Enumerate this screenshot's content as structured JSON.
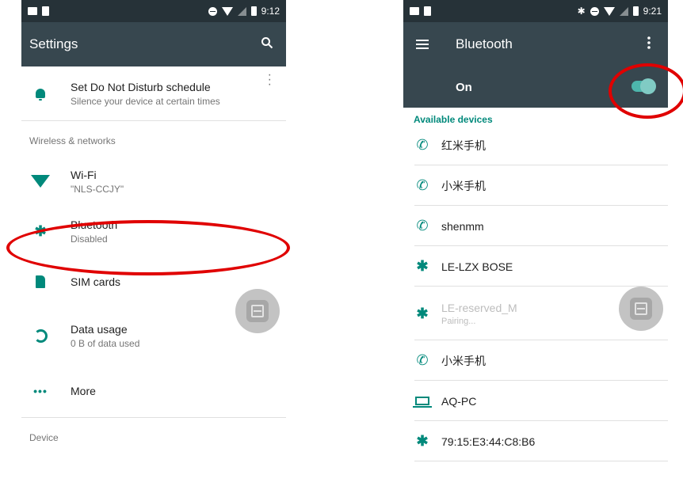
{
  "left": {
    "status_time": "9:12",
    "toolbar_title": "Settings",
    "dnd": {
      "title": "Set Do Not Disturb schedule",
      "subtitle": "Silence your device at certain times"
    },
    "section_wireless": "Wireless & networks",
    "items": [
      {
        "title": "Wi-Fi",
        "subtitle": "\"NLS-CCJY\""
      },
      {
        "title": "Bluetooth",
        "subtitle": "Disabled"
      },
      {
        "title": "SIM cards",
        "subtitle": ""
      },
      {
        "title": "Data usage",
        "subtitle": "0 B of data used"
      },
      {
        "title": "More",
        "subtitle": ""
      }
    ],
    "section_device": "Device"
  },
  "right": {
    "status_time": "9:21",
    "toolbar_title": "Bluetooth",
    "switch_label": "On",
    "switch_on": true,
    "available_header": "Available devices",
    "devices": [
      {
        "name": "红米手机",
        "icon": "phone-icon"
      },
      {
        "name": "小米手机",
        "icon": "phone-icon"
      },
      {
        "name": "shenmm",
        "icon": "phone-icon"
      },
      {
        "name": "LE-LZX BOSE",
        "icon": "bluetooth-icon"
      },
      {
        "name": "LE-reserved_M",
        "status": "Pairing...",
        "icon": "bluetooth-icon"
      },
      {
        "name": "小米手机",
        "icon": "phone-icon"
      },
      {
        "name": "AQ-PC",
        "icon": "laptop-icon"
      },
      {
        "name": "79:15:E3:44:C8:B6",
        "icon": "bluetooth-icon"
      }
    ]
  },
  "colors": {
    "toolbar": "#37474f",
    "statusbar": "#263238",
    "accent": "#00897b",
    "annotation": "#e00000"
  }
}
